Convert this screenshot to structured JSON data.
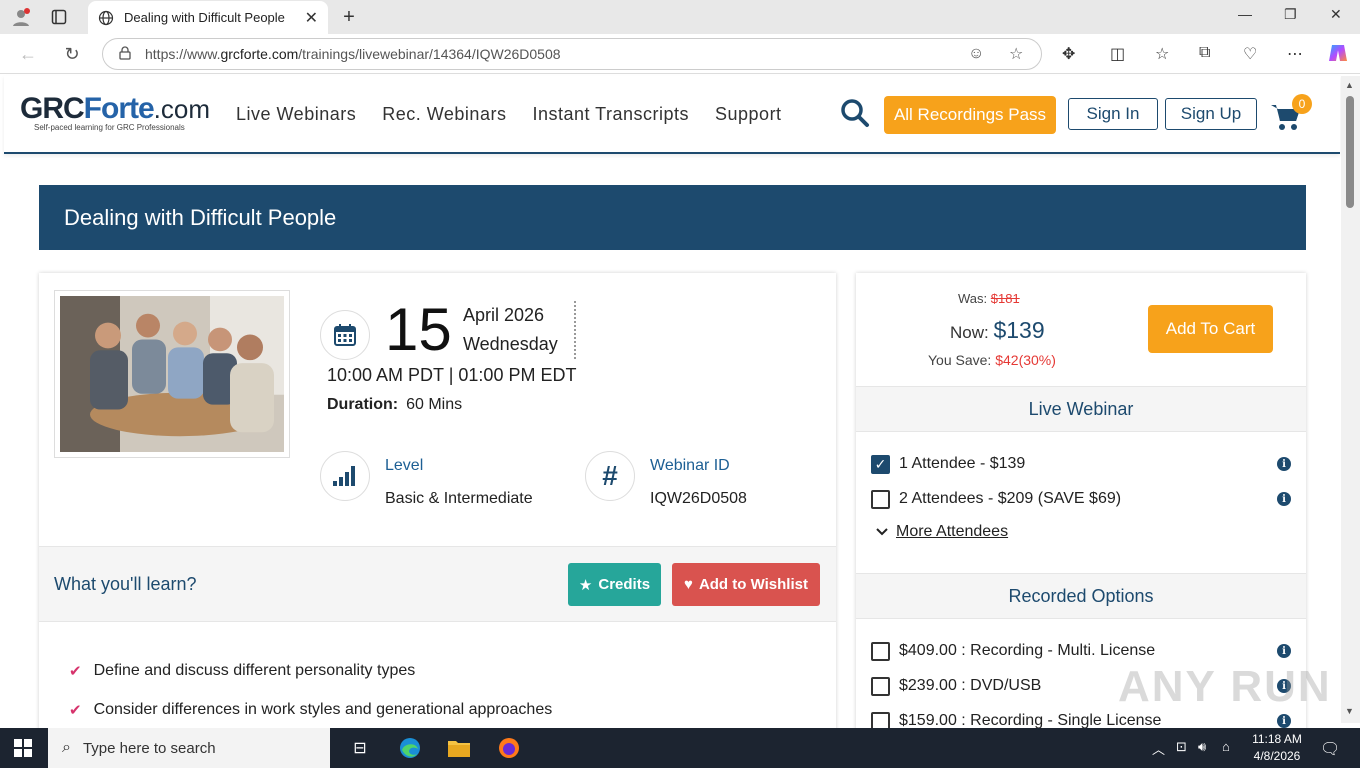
{
  "browser": {
    "tab_title": "Dealing with Difficult People",
    "url_prefix": "https://www.",
    "url_host": "grcforte.com",
    "url_path": "/trainings/livewebinar/14364/IQW26D0508"
  },
  "header": {
    "logo_grc": "GRC",
    "logo_forte": "Forte",
    "logo_com": ".com",
    "logo_tagline": "Self-paced learning for GRC Professionals",
    "menu": [
      "Live Webinars",
      "Rec. Webinars",
      "Instant Transcripts",
      "Support"
    ],
    "all_pass": "All Recordings Pass",
    "sign_in": "Sign In",
    "sign_up": "Sign Up",
    "cart_count": "0"
  },
  "page_title": "Dealing with Difficult People",
  "webinar": {
    "day": "15",
    "month_year": "April 2026",
    "weekday": "Wednesday",
    "times": "10:00 AM PDT | 01:00 PM EDT",
    "duration_label": "Duration:",
    "duration_value": "60  Mins",
    "level_label": "Level",
    "level_value": "Basic & Intermediate",
    "id_label": "Webinar ID",
    "id_value": "IQW26D0508"
  },
  "learn": {
    "title": "What you'll learn?",
    "credits": "Credits",
    "wishlist": "Add to Wishlist",
    "items": [
      "Define and discuss different personality types",
      "Consider differences in work styles and generational approaches"
    ]
  },
  "pricing": {
    "was_label": "Was:",
    "was_price": "$181",
    "now_label": "Now:",
    "now_price": "$139",
    "save_label": "You Save:",
    "save_value": "$42(30%)",
    "add_to_cart": "Add To Cart",
    "live_heading": "Live Webinar",
    "live_options": [
      {
        "label": "1 Attendee - $139",
        "checked": true
      },
      {
        "label": "2 Attendees - $209 (SAVE $69)",
        "checked": false
      }
    ],
    "more_attendees": "More Attendees",
    "recorded_heading": "Recorded Options",
    "recorded_options": [
      {
        "label": "$409.00 : Recording - Multi. License",
        "checked": false
      },
      {
        "label": "$239.00 : DVD/USB",
        "checked": false
      },
      {
        "label": "$159.00 : Recording - Single License",
        "checked": false
      }
    ]
  },
  "watermark": "ANY RUN",
  "taskbar": {
    "search_placeholder": "Type here to search",
    "time": "11:18 AM",
    "date": "4/8/2026"
  },
  "colors": {
    "primary": "#1d4a6e",
    "accent": "#f7a21b",
    "credits": "#26a69a",
    "wishlist": "#d9534f"
  }
}
